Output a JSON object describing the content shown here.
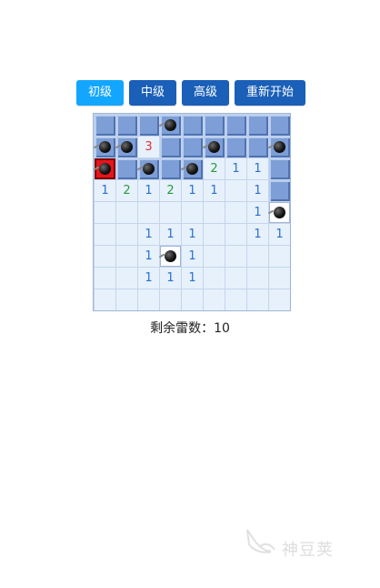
{
  "toolbar": {
    "buttons": [
      {
        "label": "初级",
        "active": true
      },
      {
        "label": "中级",
        "active": false
      },
      {
        "label": "高级",
        "active": false
      },
      {
        "label": "重新开始",
        "active": false
      }
    ]
  },
  "board": {
    "rows": 9,
    "cols": 9,
    "legend": "C=closed, O=open empty, M=mine on closed, X=exploded mine, W=mine on open, digit=number",
    "grid": [
      [
        "C",
        "C",
        "C",
        "M",
        "C",
        "C",
        "C",
        "C",
        "C"
      ],
      [
        "M",
        "M",
        "3",
        "C",
        "C",
        "M",
        "C",
        "C",
        "M"
      ],
      [
        "X",
        "C",
        "M",
        "C",
        "M",
        "2",
        "1",
        "1",
        "C"
      ],
      [
        "1",
        "2",
        "1",
        "2",
        "1",
        "1",
        "O",
        "1",
        "C"
      ],
      [
        "O",
        "O",
        "O",
        "O",
        "O",
        "O",
        "O",
        "1",
        "W"
      ],
      [
        "O",
        "O",
        "1",
        "1",
        "1",
        "O",
        "O",
        "1",
        "1"
      ],
      [
        "O",
        "O",
        "1",
        "W",
        "1",
        "O",
        "O",
        "O",
        "O"
      ],
      [
        "O",
        "O",
        "1",
        "1",
        "1",
        "O",
        "O",
        "O",
        "O"
      ],
      [
        "O",
        "O",
        "O",
        "O",
        "O",
        "O",
        "O",
        "O",
        "O"
      ]
    ]
  },
  "status": {
    "text": "剩余雷数：10"
  },
  "colors": {
    "active_button": "#12a6ff",
    "button": "#1a5fb8",
    "closed_cell": "#7d9ed6",
    "open_cell": "#e6f1fc",
    "exploded": "#e8141b",
    "num1": "#2b6fd1",
    "num2": "#2a9a3c",
    "num3": "#e0322c"
  },
  "watermark": {
    "text": "神豆荚",
    "icon": "bird-logo-icon"
  }
}
